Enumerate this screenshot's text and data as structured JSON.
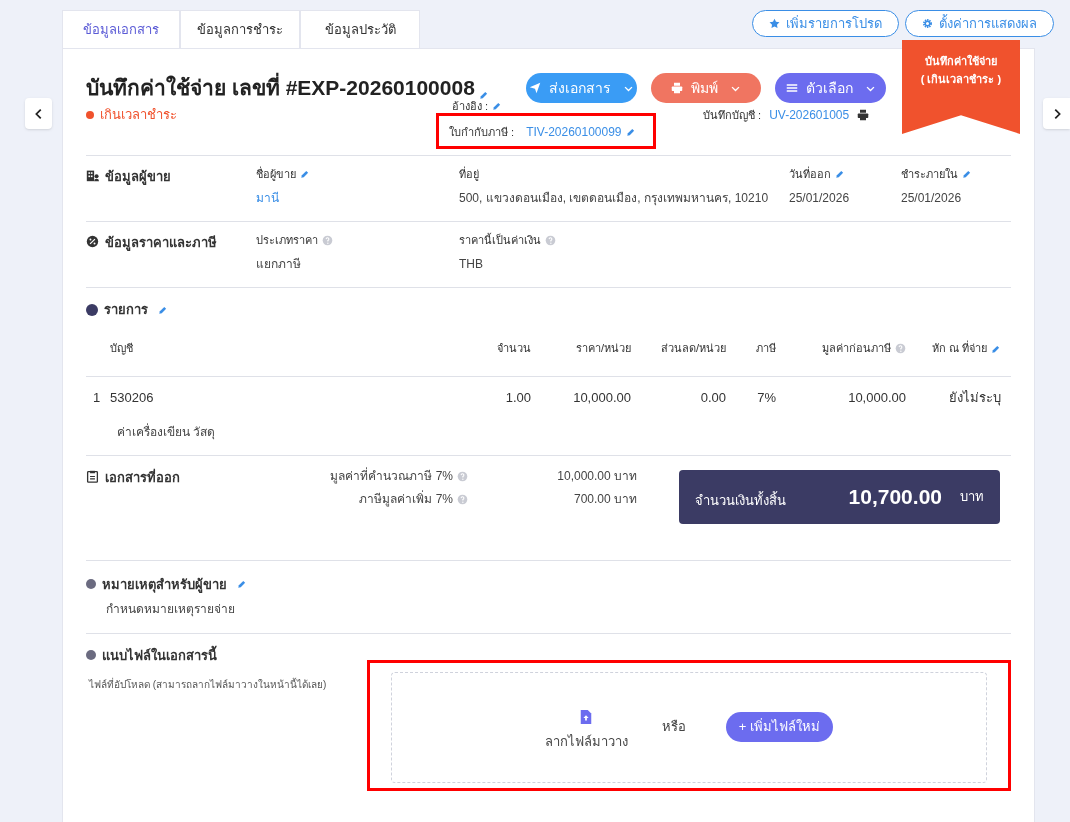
{
  "tabs": [
    {
      "label": "ข้อมูลเอกสาร",
      "selected": true
    },
    {
      "label": "ข้อมูลการชำระ",
      "selected": false
    },
    {
      "label": "ข้อมูลประวัติ",
      "selected": false
    }
  ],
  "top_actions": [
    {
      "label": "เพิ่มรายการโปรด",
      "kind": "star"
    },
    {
      "label": "ตั้งค่าการแสดงผล",
      "kind": "gear"
    }
  ],
  "ribbon": [
    "บันทึกค่าใช้จ่าย",
    "( เกินเวลาชำระ )"
  ],
  "title": "บันทึกค่าใช้จ่าย เลขที่ #EXP-20260100008",
  "action_buttons": [
    {
      "label": "ส่งเอกสาร",
      "kind": "send"
    },
    {
      "label": "พิมพ์",
      "kind": "print"
    },
    {
      "label": "ตัวเลือก",
      "kind": "options"
    }
  ],
  "status": {
    "label": "เกินเวลาชำระ",
    "color": "#f0522d"
  },
  "reference": {
    "label": "อ้างอิง :"
  },
  "tax_invoice": {
    "label": "ใบกำกับภาษี :",
    "value": "TIV-20260100099",
    "highlighted": true
  },
  "journal": {
    "label": "บันทึกบัญชี :",
    "value": "UV-202601005"
  },
  "sections": [
    {
      "heading": "ข้อมูลผู้ขาย",
      "kind": "building",
      "fields": [
        {
          "label": "ชื่อผู้ขาย",
          "value": "มานี",
          "kind": "linked"
        },
        {
          "label": "ที่อยู่",
          "value": "500, แขวงดอนเมือง, เขตดอนเมือง, กรุงเทพมหานคร, 10210",
          "kind": "plain"
        },
        {
          "label": "วันที่ออก",
          "value": "25/01/2026",
          "kind": "editable"
        },
        {
          "label": "ชำระภายใน",
          "value": "25/01/2026",
          "kind": "editable"
        }
      ]
    },
    {
      "heading": "ข้อมูลราคาและภาษี",
      "kind": "percent",
      "fields": [
        {
          "label": "ประเภทราคา",
          "value": "แยกภาษี",
          "kind": "help"
        },
        {
          "label": "ราคานี้เป็นค่าเงิน",
          "value": "THB",
          "kind": "help"
        }
      ]
    }
  ],
  "items": {
    "heading": "รายการ",
    "columns": [
      {
        "label": "บัญชี",
        "kind": "plain"
      },
      {
        "label": "จำนวน",
        "kind": "plain"
      },
      {
        "label": "ราคา/หน่วย",
        "kind": "plain"
      },
      {
        "label": "ส่วนลด/หน่วย",
        "kind": "plain"
      },
      {
        "label": "ภาษี",
        "kind": "plain"
      },
      {
        "label": "มูลค่าก่อนภาษี",
        "kind": "help"
      },
      {
        "label": "หัก ณ ที่จ่าย",
        "kind": "editable"
      }
    ],
    "rows": [
      {
        "number": "1",
        "cells": [
          "530206",
          "1.00",
          "10,000.00",
          "0.00",
          "7%",
          "10,000.00",
          "ยังไม่ระบุ"
        ],
        "description": "ค่าเครื่องเขียน วัสดุ"
      }
    ]
  },
  "summary": {
    "heading": "เอกสารที่ออก",
    "lines": [
      {
        "label": "มูลค่าที่คำนวณภาษี 7%",
        "value": "10,000.00 บาท"
      },
      {
        "label": "ภาษีมูลค่าเพิ่ม 7%",
        "value": "700.00 บาท"
      }
    ],
    "total": {
      "label": "จำนวนเงินทั้งสิ้น",
      "amount": "10,700.00",
      "currency": "บาท"
    }
  },
  "notes": {
    "heading": "หมายเหตุสำหรับผู้ขาย",
    "text": "กำหนดหมายเหตุรายจ่าย"
  },
  "attachments": {
    "heading": "แนบไฟล์ในเอกสารนี้",
    "hint": "ไฟล์ที่อัปโหลด (สามารถลากไฟล์มาวางในหน้านี้ได้เลย)",
    "drop_label": "ลากไฟล์มาวาง",
    "or": "หรือ",
    "add_button": "+ เพิ่มไฟล์ใหม่",
    "highlighted": true
  }
}
